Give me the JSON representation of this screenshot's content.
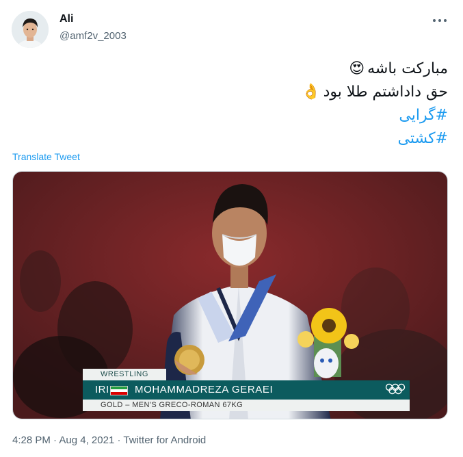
{
  "user": {
    "display_name": "Ali",
    "handle": "@amf2v_2003",
    "avatar_icon": "user-avatar"
  },
  "tweet": {
    "line1": "مبارکت باشه",
    "line1_emoji": "😍",
    "line2": "حق داداشتم طلا بود",
    "line2_emoji": "👌",
    "hashtag1": "#گرایی",
    "hashtag2": "#کشتی"
  },
  "translate_label": "Translate Tweet",
  "media": {
    "category": "WRESTLING",
    "country": "IRI",
    "athlete": "MOHAMMADREZA GERAEI",
    "event": "GOLD – MEN'S GRECO-ROMAN 67KG"
  },
  "meta": {
    "time": "4:28 PM",
    "separator": "·",
    "date": "Aug 4, 2021",
    "source": "Twitter for Android"
  },
  "colors": {
    "link": "#1d9bf0",
    "text": "#0f1419",
    "secondary": "#536471",
    "broadcast_teal": "#0c5b5e"
  }
}
